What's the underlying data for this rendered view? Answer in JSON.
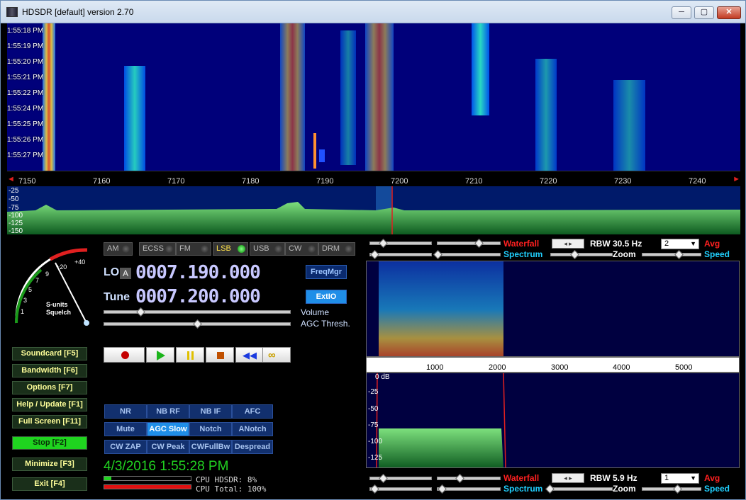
{
  "window": {
    "title": "HDSDR [default]  version 2.70",
    "controls": {
      "minimize": "─",
      "maximize": "▢",
      "close": "✕"
    }
  },
  "waterfall": {
    "time_labels": [
      "1:55:18 PM",
      "1:55:19 PM",
      "1:55:20 PM",
      "1:55:21 PM",
      "1:55:22 PM",
      "1:55:24 PM",
      "1:55:25 PM",
      "1:55:26 PM",
      "1:55:27 PM"
    ]
  },
  "frequency_axis": {
    "ticks": [
      "7150",
      "7160",
      "7170",
      "7180",
      "7190",
      "7200",
      "7210",
      "7220",
      "7230",
      "7240"
    ],
    "left_arrow": "◄",
    "right_arrow": "►"
  },
  "spectrum": {
    "db_labels": [
      "-25",
      "-50",
      "-75",
      "-100",
      "-125",
      "-150"
    ]
  },
  "smeter": {
    "label_line1": "S-units",
    "label_line2": "Squelch",
    "scale": [
      "1",
      "3",
      "5",
      "7",
      "9",
      "+20",
      "+40"
    ]
  },
  "modes": [
    {
      "label": "AM",
      "active": false
    },
    {
      "label": "ECSS",
      "active": false
    },
    {
      "label": "FM",
      "active": false
    },
    {
      "label": "LSB",
      "active": true
    },
    {
      "label": "USB",
      "active": false
    },
    {
      "label": "CW",
      "active": false
    },
    {
      "label": "DRM",
      "active": false
    }
  ],
  "lo": {
    "label": "LO",
    "badge": "A",
    "value": "0007.190.000"
  },
  "tune": {
    "label": "Tune",
    "value": "0007.200.000"
  },
  "freqmgr_label": "FreqMgr",
  "extio_label": "ExtIO",
  "volume_label": "Volume",
  "agc_thresh_label": "AGC Thresh.",
  "left_buttons": [
    "Soundcard  [F5]",
    "Bandwidth  [F6]",
    "Options    [F7]",
    "Help / Update  [F1]",
    "Full Screen  [F11]",
    "Stop           [F2]",
    "Minimize  [F3]",
    "Exit          [F4]"
  ],
  "dsp_buttons": [
    [
      "NR",
      "NB RF",
      "NB IF",
      "AFC"
    ],
    [
      "Mute",
      "AGC Slow",
      "Notch",
      "ANotch"
    ],
    [
      "CW ZAP",
      "CW Peak",
      "CWFullBw",
      "Despread"
    ]
  ],
  "clock": "4/3/2016 1:55:28 PM",
  "cpu": {
    "hdsdr": "CPU HDSDR: 8%",
    "total": "CPU Total: 100%"
  },
  "audio_top": {
    "waterfall_label": "Waterfall",
    "spectrum_label": "Spectrum",
    "rbw": "RBW 30.5 Hz",
    "zoom_label": "Zoom",
    "avg_value": "2",
    "avg_label": "Avg",
    "speed_label": "Speed"
  },
  "audio_axis": {
    "ticks": [
      "1000",
      "2000",
      "3000",
      "4000",
      "5000"
    ]
  },
  "audio_spectrum": {
    "db_labels": [
      "0 dB",
      "-25",
      "-50",
      "-75",
      "-100",
      "-125"
    ]
  },
  "audio_bottom": {
    "waterfall_label": "Waterfall",
    "spectrum_label": "Spectrum",
    "rbw": "RBW   5.9 Hz",
    "zoom_label": "Zoom",
    "avg_value": "1",
    "avg_label": "Avg",
    "speed_label": "Speed"
  },
  "colors": {
    "waterfall_label": "#ff2020",
    "spectrum_label": "#20d0ff",
    "clock": "#21d321",
    "lcd": "#c8c8ff"
  }
}
